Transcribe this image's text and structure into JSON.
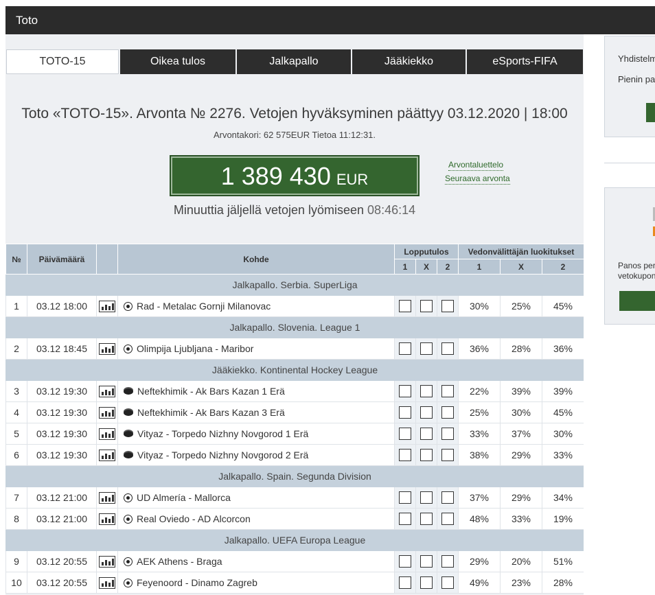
{
  "header": {
    "title": "Toto"
  },
  "tabs": [
    {
      "label": "TOTO-15",
      "active": true
    },
    {
      "label": "Oikea tulos",
      "active": false
    },
    {
      "label": "Jalkapallo",
      "active": false
    },
    {
      "label": "Jääkiekko",
      "active": false
    },
    {
      "label": "eSports-FIFA",
      "active": false
    }
  ],
  "draw": {
    "headline": "Toto «TOTO-15». Arvonta № 2276. Vetojen hyväksyminen päättyy 03.12.2020 | 18:00",
    "subline": "Arvontakori: 62 575EUR Tietoa 11:12:31.",
    "jackpot_amount": "1 389 430",
    "jackpot_currency": "EUR",
    "link_draw_list": "Arvontaluettelo",
    "link_next_draw": "Seuraava arvonta",
    "countdown_label": "Minuuttia jäljellä vetojen lyömiseen",
    "countdown_time": "08:46:14"
  },
  "table": {
    "headers": {
      "no": "№",
      "date": "Päivämäärä",
      "event": "Kohde",
      "final_result": "Lopputulos",
      "bookmaker": "Vedonvälittäjän luokitukset",
      "o1": "1",
      "ox": "X",
      "o2": "2",
      "b1": "1",
      "bx": "X",
      "b2": "2"
    },
    "rows": [
      {
        "type": "group",
        "label": "Jalkapallo. Serbia. SuperLiga"
      },
      {
        "type": "match",
        "no": "1",
        "date": "03.12 18:00",
        "sport": "football",
        "event": "Rad - Metalac Gornji Milanovac",
        "p1": "30%",
        "px": "25%",
        "p2": "45%"
      },
      {
        "type": "group",
        "label": "Jalkapallo. Slovenia. League 1"
      },
      {
        "type": "match",
        "no": "2",
        "date": "03.12 18:45",
        "sport": "football",
        "event": "Olimpija Ljubljana - Maribor",
        "p1": "36%",
        "px": "28%",
        "p2": "36%"
      },
      {
        "type": "group",
        "label": "Jääkiekko. Kontinental Hockey League"
      },
      {
        "type": "match",
        "no": "3",
        "date": "03.12 19:30",
        "sport": "hockey",
        "event": "Neftekhimik - Ak Bars Kazan 1 Erä",
        "p1": "22%",
        "px": "39%",
        "p2": "39%"
      },
      {
        "type": "match",
        "no": "4",
        "date": "03.12 19:30",
        "sport": "hockey",
        "event": "Neftekhimik - Ak Bars Kazan 3 Erä",
        "p1": "25%",
        "px": "30%",
        "p2": "45%"
      },
      {
        "type": "match",
        "no": "5",
        "date": "03.12 19:30",
        "sport": "hockey",
        "event": "Vityaz - Torpedo Nizhny Novgorod 1 Erä",
        "p1": "33%",
        "px": "37%",
        "p2": "30%"
      },
      {
        "type": "match",
        "no": "6",
        "date": "03.12 19:30",
        "sport": "hockey",
        "event": "Vityaz - Torpedo Nizhny Novgorod 2 Erä",
        "p1": "38%",
        "px": "29%",
        "p2": "33%"
      },
      {
        "type": "group",
        "label": "Jalkapallo. Spain. Segunda Division"
      },
      {
        "type": "match",
        "no": "7",
        "date": "03.12 21:00",
        "sport": "football",
        "event": "UD Almería - Mallorca",
        "p1": "37%",
        "px": "29%",
        "p2": "34%"
      },
      {
        "type": "match",
        "no": "8",
        "date": "03.12 21:00",
        "sport": "football",
        "event": "Real Oviedo - AD Alcorcon",
        "p1": "48%",
        "px": "33%",
        "p2": "19%"
      },
      {
        "type": "group",
        "label": "Jalkapallo. UEFA Europa League"
      },
      {
        "type": "match",
        "no": "9",
        "date": "03.12 20:55",
        "sport": "football",
        "event": "AEK Athens - Braga",
        "p1": "29%",
        "px": "20%",
        "p2": "51%"
      },
      {
        "type": "match",
        "no": "10",
        "date": "03.12 20:55",
        "sport": "football",
        "event": "Feyenoord - Dinamo Zagreb",
        "p1": "49%",
        "px": "23%",
        "p2": "28%"
      }
    ]
  },
  "right_panel": {
    "text1": "Yhdistelm",
    "text2": "Pienin pa",
    "text3": "Panos per",
    "text4": "vetokupon",
    "accent_green": "#34652f",
    "accent_orange": "#e8891e"
  }
}
